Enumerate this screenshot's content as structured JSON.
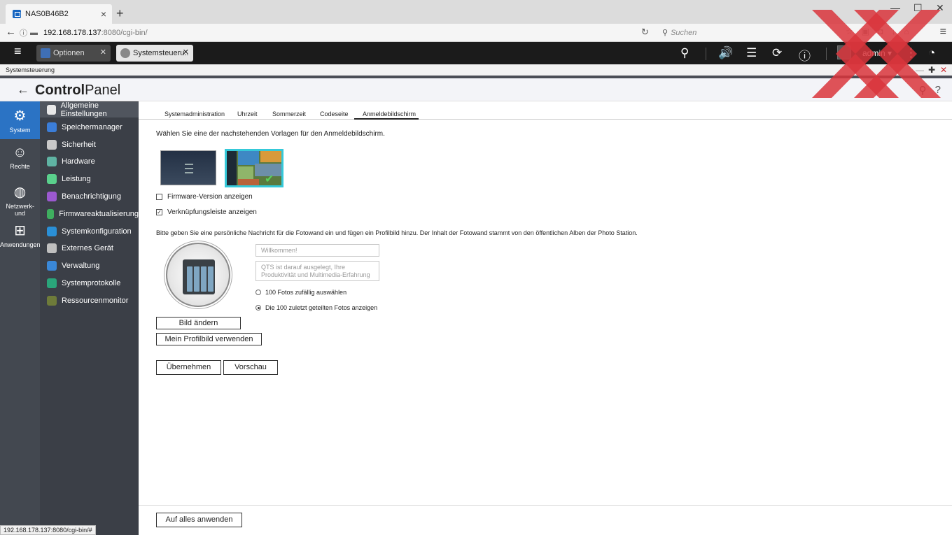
{
  "browser": {
    "tab_title": "NAS0B46B2",
    "url_host": "192.168.178.137",
    "url_rest": ":8080/cgi-bin/",
    "search_placeholder": "Suchen",
    "status_url": "192.168.178.137:8080/cgi-bin/#"
  },
  "qts": {
    "app_tabs": [
      {
        "label": "Optionen"
      },
      {
        "label": "Systemsteueru.."
      }
    ],
    "user": "admin"
  },
  "window": {
    "title": "Systemsteuerung"
  },
  "control_panel": {
    "title_bold": "Control",
    "title_rest": "Panel"
  },
  "rail": [
    {
      "label": "System",
      "icon": "gear-icon"
    },
    {
      "label": "Rechte",
      "icon": "user-icon"
    },
    {
      "label": "Netzwerk- und",
      "icon": "globe-icon"
    },
    {
      "label": "Anwendungen",
      "icon": "apps-icon"
    }
  ],
  "categories": [
    {
      "label": "Allgemeine Einstellungen",
      "color": "#e8e8e8"
    },
    {
      "label": "Speichermanager",
      "color": "#3b7dd8"
    },
    {
      "label": "Sicherheit",
      "color": "#c9c9c9"
    },
    {
      "label": "Hardware",
      "color": "#5fb3a3"
    },
    {
      "label": "Leistung",
      "color": "#5ad08c"
    },
    {
      "label": "Benachrichtigung",
      "color": "#9b59d0"
    },
    {
      "label": "Firmwareaktualisierung",
      "color": "#3fae5f"
    },
    {
      "label": "Systemkonfiguration",
      "color": "#2a8fd6"
    },
    {
      "label": "Externes Gerät",
      "color": "#bfbfbf"
    },
    {
      "label": "Verwaltung",
      "color": "#3a88d8"
    },
    {
      "label": "Systemprotokolle",
      "color": "#2aa57a"
    },
    {
      "label": "Ressourcenmonitor",
      "color": "#6e7b3a"
    }
  ],
  "subtabs": [
    {
      "label": "Systemadministration"
    },
    {
      "label": "Uhrzeit"
    },
    {
      "label": "Sommerzeit"
    },
    {
      "label": "Codeseite"
    },
    {
      "label": "Anmeldebildschirm"
    }
  ],
  "login_screen": {
    "intro": "Wählen Sie eine der nachstehenden Vorlagen für den Anmeldebildschirm.",
    "show_firmware": {
      "label": "Firmware-Version anzeigen",
      "checked": false
    },
    "show_linkbar": {
      "label": "Verknüpfungsleiste anzeigen",
      "checked": true
    },
    "photo_wall_text": "Bitte geben Sie eine persönliche Nachricht für die Fotowand ein und fügen ein Profilbild hinzu. Der Inhalt der Fotowand stammt von den öffentlichen Alben der Photo Station.",
    "welcome_placeholder": "Willkommen!",
    "message_placeholder": "QTS ist darauf ausgelegt, Ihre Produktivität und Multimedia-Erfahrung",
    "radio_random": {
      "label": "100 Fotos zufällig auswählen",
      "selected": false
    },
    "radio_recent": {
      "label": "Die 100 zuletzt geteilten Fotos anzeigen",
      "selected": true
    },
    "btn_change_image": "Bild ändern",
    "btn_use_profile": "Mein Profilbild verwenden",
    "btn_apply": "Übernehmen",
    "btn_preview": "Vorschau",
    "btn_apply_all": "Auf alles anwenden"
  }
}
